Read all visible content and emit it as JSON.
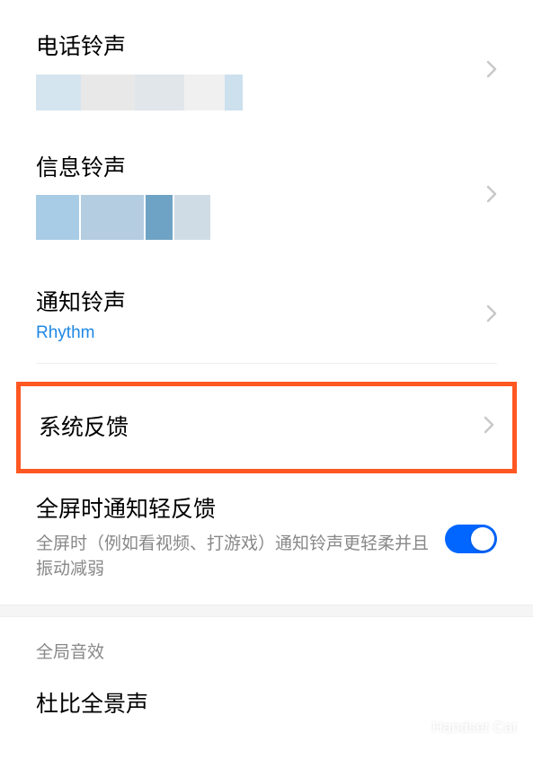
{
  "items": {
    "phone_ringtone": {
      "title": "电话铃声"
    },
    "sms_ringtone": {
      "title": "信息铃声"
    },
    "notification_ringtone": {
      "title": "通知铃声",
      "value": "Rhythm"
    },
    "system_feedback": {
      "title": "系统反馈"
    },
    "fullscreen_feedback": {
      "title": "全屏时通知轻反馈",
      "description": "全屏时（例如看视频、打游戏）通知铃声更轻柔并且振动减弱",
      "enabled": true
    },
    "dolby": {
      "title": "杜比全景声"
    }
  },
  "section_header": "全局音效",
  "watermark": "Handset Cat"
}
